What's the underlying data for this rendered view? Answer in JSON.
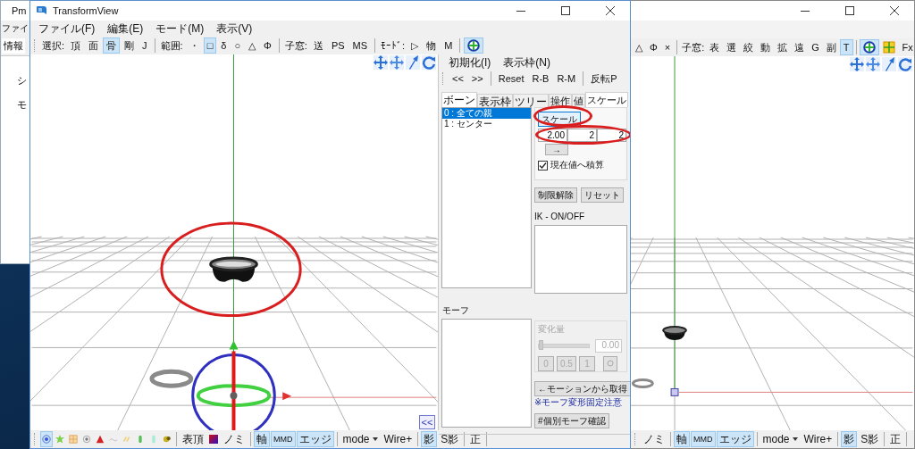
{
  "back_window": {
    "title": "Pm",
    "menu": [
      "ファイ"
    ],
    "tabs": [
      {
        "label": "情報",
        "selected": true
      }
    ],
    "texts": [
      "シ",
      "モ"
    ]
  },
  "main_window": {
    "title": "TransformView",
    "menu": [
      "ファイル(F)",
      "編集(E)",
      "モード(M)",
      "表示(V)"
    ],
    "toolbar": [
      {
        "kind": "label",
        "text": "選択:"
      },
      {
        "kind": "tool",
        "text": "頂",
        "selected": false
      },
      {
        "kind": "tool",
        "text": "面",
        "selected": false
      },
      {
        "kind": "tool",
        "text": "骨",
        "selected": true
      },
      {
        "kind": "tool",
        "text": "剛",
        "selected": false
      },
      {
        "kind": "tool",
        "text": "J",
        "selected": false
      },
      {
        "kind": "sep"
      },
      {
        "kind": "label",
        "text": "範囲:"
      },
      {
        "kind": "tool",
        "text": "・",
        "selected": false
      },
      {
        "kind": "tool",
        "text": "□",
        "selected": true
      },
      {
        "kind": "tool",
        "text": "δ",
        "selected": false
      },
      {
        "kind": "tool",
        "text": "○",
        "selected": false
      },
      {
        "kind": "tool",
        "text": "△",
        "selected": false
      },
      {
        "kind": "tool",
        "text": "Φ",
        "selected": false
      },
      {
        "kind": "sep"
      },
      {
        "kind": "label",
        "text": "子窓:"
      },
      {
        "kind": "tool",
        "text": "送",
        "selected": false
      },
      {
        "kind": "tool",
        "text": "PS",
        "selected": false
      },
      {
        "kind": "tool",
        "text": "MS",
        "selected": false
      },
      {
        "kind": "sep"
      },
      {
        "kind": "label",
        "text": "ﾓｰﾄﾞ:"
      },
      {
        "kind": "tool",
        "text": "▷",
        "selected": false
      },
      {
        "kind": "tool",
        "text": "物",
        "selected": false
      },
      {
        "kind": "tool",
        "text": "M",
        "selected": false
      },
      {
        "kind": "sep"
      },
      {
        "kind": "icon",
        "selected": true
      }
    ],
    "bottom_toolbar": [
      {
        "kind": "icon",
        "selected": true
      },
      {
        "kind": "icon",
        "selected": false
      },
      {
        "kind": "icon",
        "selected": false
      },
      {
        "kind": "icon",
        "selected": false
      },
      {
        "kind": "icon",
        "selected": false
      },
      {
        "kind": "icon",
        "selected": false
      },
      {
        "kind": "icon",
        "selected": false
      },
      {
        "kind": "icon",
        "selected": false
      },
      {
        "kind": "icon",
        "selected": false
      },
      {
        "kind": "icon",
        "selected": false
      },
      {
        "kind": "sep"
      },
      {
        "kind": "tool",
        "text": "表頂",
        "selected": false
      },
      {
        "kind": "icon",
        "selected": false
      },
      {
        "kind": "tool",
        "text": "ノミ",
        "selected": false
      },
      {
        "kind": "sep"
      },
      {
        "kind": "tool",
        "text": "軸",
        "selected": true
      },
      {
        "kind": "tool",
        "text": "MMD",
        "selected": true
      },
      {
        "kind": "tool",
        "text": "エッジ",
        "selected": true
      },
      {
        "kind": "sep"
      },
      {
        "kind": "dropdown",
        "text": "mode"
      },
      {
        "kind": "tool",
        "text": "Wire+",
        "selected": false
      },
      {
        "kind": "sep"
      },
      {
        "kind": "tool",
        "text": "影",
        "selected": true
      },
      {
        "kind": "tool",
        "text": "S影",
        "selected": false
      },
      {
        "kind": "sep"
      },
      {
        "kind": "tool",
        "text": "正",
        "selected": false
      },
      {
        "kind": "sep"
      }
    ],
    "collapse_button": "<<",
    "panel": {
      "menu": [
        "初期化(I)",
        "表示枠(N)"
      ],
      "toolbar": [
        {
          "kind": "tool",
          "text": "<<"
        },
        {
          "kind": "tool",
          "text": ">>"
        },
        {
          "kind": "sep"
        },
        {
          "kind": "tool",
          "text": "Reset"
        },
        {
          "kind": "tool",
          "text": "R-B"
        },
        {
          "kind": "tool",
          "text": "R-M"
        },
        {
          "kind": "sep"
        },
        {
          "kind": "tool",
          "text": "反転P"
        }
      ],
      "list_tabs": [
        {
          "label": "ボーン",
          "selected": true
        },
        {
          "label": "表示枠",
          "selected": false
        },
        {
          "label": "ツリー",
          "selected": false
        }
      ],
      "bones": [
        {
          "text": "0 : 全ての親",
          "selected": true
        },
        {
          "text": "1 : センター",
          "selected": false
        }
      ],
      "edit_tabs": [
        {
          "label": "操作",
          "selected": false
        },
        {
          "label": "値",
          "selected": false
        },
        {
          "label": "スケール",
          "selected": true
        }
      ],
      "scale_button": "スケール",
      "scale_values": [
        "2.00",
        "2",
        "2"
      ],
      "apply_button": "→",
      "accumulate": {
        "label": "現在値へ積算",
        "checked": true
      },
      "buttons": [
        "制限解除",
        "リセット"
      ],
      "ik_label": "IK - ON/OFF",
      "morph_label": "モーフ",
      "morph_amount": {
        "title": "変化量",
        "disabled": true,
        "level": 0,
        "value": "0.00",
        "presets": [
          "0",
          "0.5",
          "1"
        ]
      },
      "motion_button": "←モーションから取得",
      "note": "※モーフ変形固定注意",
      "check_button": "#個別モーフ確認"
    }
  },
  "view_window": {
    "toolbar": [
      {
        "kind": "tool",
        "text": "△",
        "selected": false
      },
      {
        "kind": "tool",
        "text": "Φ",
        "selected": false
      },
      {
        "kind": "tool",
        "text": "×",
        "selected": false
      },
      {
        "kind": "sep"
      },
      {
        "kind": "label",
        "text": "子窓:"
      },
      {
        "kind": "tool",
        "text": "表",
        "selected": false
      },
      {
        "kind": "tool",
        "text": "選",
        "selected": false
      },
      {
        "kind": "tool",
        "text": "絞",
        "selected": false
      },
      {
        "kind": "tool",
        "text": "動",
        "selected": false
      },
      {
        "kind": "tool",
        "text": "拡",
        "selected": false
      },
      {
        "kind": "tool",
        "text": "遠",
        "selected": false
      },
      {
        "kind": "tool",
        "text": "G",
        "selected": false
      },
      {
        "kind": "tool",
        "text": "副",
        "selected": false
      },
      {
        "kind": "tool",
        "text": "T",
        "selected": true
      },
      {
        "kind": "sep"
      },
      {
        "kind": "icon",
        "selected": true
      },
      {
        "kind": "icon",
        "selected": false
      },
      {
        "kind": "tool",
        "text": "Fx",
        "selected": false
      }
    ],
    "bottom_toolbar": [
      {
        "kind": "tool",
        "text": "ノミ",
        "selected": false
      },
      {
        "kind": "sep"
      },
      {
        "kind": "tool",
        "text": "軸",
        "selected": true
      },
      {
        "kind": "tool",
        "text": "MMD",
        "selected": true
      },
      {
        "kind": "tool",
        "text": "エッジ",
        "selected": true
      },
      {
        "kind": "sep"
      },
      {
        "kind": "dropdown",
        "text": "mode"
      },
      {
        "kind": "tool",
        "text": "Wire+",
        "selected": false
      },
      {
        "kind": "sep"
      },
      {
        "kind": "tool",
        "text": "影",
        "selected": true
      },
      {
        "kind": "tool",
        "text": "S影",
        "selected": false
      },
      {
        "kind": "sep"
      },
      {
        "kind": "tool",
        "text": "正",
        "selected": false
      },
      {
        "kind": "sep"
      }
    ]
  }
}
